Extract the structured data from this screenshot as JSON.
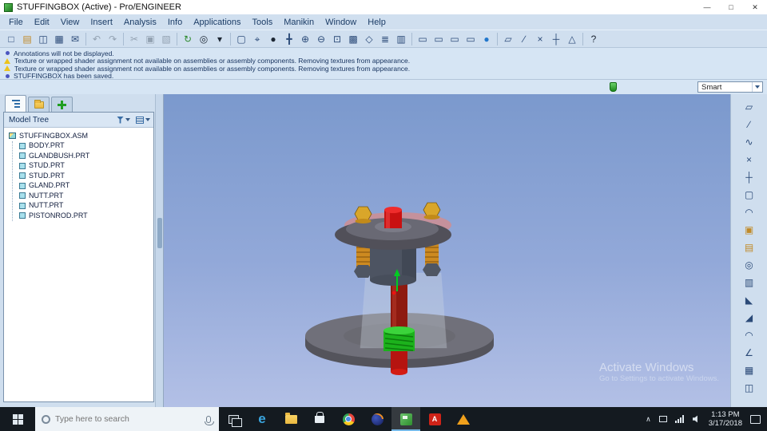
{
  "window": {
    "title": "STUFFINGBOX (Active) - Pro/ENGINEER",
    "minimize": "—",
    "maximize": "□",
    "close": "✕"
  },
  "menubar": {
    "items": [
      "File",
      "Edit",
      "View",
      "Insert",
      "Analysis",
      "Info",
      "Applications",
      "Tools",
      "Manikin",
      "Window",
      "Help"
    ]
  },
  "toolbar": {
    "icons": [
      {
        "name": "new-file-icon",
        "glyph": "□",
        "cls": "tbi tone-blue"
      },
      {
        "name": "open-folder-icon",
        "glyph": "▤",
        "cls": "tbi tone-gold"
      },
      {
        "name": "save-icon",
        "glyph": "◫",
        "cls": "tbi tone-blue"
      },
      {
        "name": "print-icon",
        "glyph": "▦",
        "cls": "tbi tone-blue"
      },
      {
        "name": "mail-icon",
        "glyph": "✉",
        "cls": "tbi tone-blue"
      },
      {
        "name": "undo-icon",
        "glyph": "↶",
        "cls": "tbi tone-gray"
      },
      {
        "name": "redo-icon",
        "glyph": "↷",
        "cls": "tbi tone-gray"
      },
      {
        "name": "cut-icon",
        "glyph": "✂",
        "cls": "tbi tone-gray"
      },
      {
        "name": "copy-icon",
        "glyph": "▣",
        "cls": "tbi tone-gray"
      },
      {
        "name": "paste-icon",
        "glyph": "▧",
        "cls": "tbi tone-gray"
      },
      {
        "name": "regenerate-icon",
        "glyph": "↻",
        "cls": "tbi tone-green"
      },
      {
        "name": "find-icon",
        "glyph": "◎",
        "cls": "tbi tone-dark"
      },
      {
        "name": "filter-caret-icon",
        "glyph": "▾",
        "cls": "tbi tone-dark"
      },
      {
        "name": "select-box-icon",
        "glyph": "▢",
        "cls": "tbi tone-blue"
      },
      {
        "name": "pick-target-icon",
        "glyph": "⌖",
        "cls": "tbi tone-blue"
      },
      {
        "name": "shaded-view-icon",
        "glyph": "●",
        "cls": "tbi tone-dark"
      },
      {
        "name": "spin-center-icon",
        "glyph": "╋",
        "cls": "tbi tone-blue"
      },
      {
        "name": "zoom-in-icon",
        "glyph": "⊕",
        "cls": "tbi tone-blue"
      },
      {
        "name": "zoom-out-icon",
        "glyph": "⊖",
        "cls": "tbi tone-blue"
      },
      {
        "name": "refit-icon",
        "glyph": "⊡",
        "cls": "tbi tone-blue"
      },
      {
        "name": "repaint-icon",
        "glyph": "▩",
        "cls": "tbi tone-blue"
      },
      {
        "name": "orientation-icon",
        "glyph": "◇",
        "cls": "tbi tone-blue"
      },
      {
        "name": "layers-icon",
        "glyph": "≣",
        "cls": "tbi tone-blue"
      },
      {
        "name": "view-manager-icon",
        "glyph": "▥",
        "cls": "tbi tone-blue"
      },
      {
        "name": "new-window-icon",
        "glyph": "▭",
        "cls": "tbi tone-blue"
      },
      {
        "name": "close-window-icon",
        "glyph": "▭",
        "cls": "tbi tone-blue"
      },
      {
        "name": "tile-window-icon",
        "glyph": "▭",
        "cls": "tbi tone-blue"
      },
      {
        "name": "activate-window-icon",
        "glyph": "▭",
        "cls": "tbi tone-blue"
      },
      {
        "name": "user-icon",
        "glyph": "●",
        "cls": "tbi tone-bright"
      },
      {
        "name": "datum-plane-toggle-icon",
        "glyph": "▱",
        "cls": "tbi tone-blue"
      },
      {
        "name": "datum-axis-toggle-icon",
        "glyph": "∕",
        "cls": "tbi tone-blue"
      },
      {
        "name": "datum-point-toggle-icon",
        "glyph": "×",
        "cls": "tbi tone-blue"
      },
      {
        "name": "csys-toggle-icon",
        "glyph": "┼",
        "cls": "tbi tone-blue"
      },
      {
        "name": "annotation-toggle-icon",
        "glyph": "△",
        "cls": "tbi tone-blue"
      },
      {
        "name": "help-pointer-icon",
        "glyph": "?",
        "cls": "tbi tone-dark"
      }
    ]
  },
  "messages": {
    "lines": [
      {
        "type": "info",
        "text": "Annotations will not be displayed."
      },
      {
        "type": "warning",
        "text": "Texture or wrapped shader assignment not available on assemblies or assembly components. Removing textures from appearance."
      },
      {
        "type": "warning",
        "text": "Texture or wrapped shader assignment not available on assemblies or assembly components. Removing textures from appearance."
      },
      {
        "type": "info",
        "text": "STUFFINGBOX has been saved."
      }
    ]
  },
  "selection_filter": {
    "value": "Smart"
  },
  "model_tree": {
    "header": "Model Tree",
    "root": "STUFFINGBOX.ASM",
    "items": [
      "BODY.PRT",
      "GLANDBUSH.PRT",
      "STUD.PRT",
      "STUD.PRT",
      "GLAND.PRT",
      "NUTT.PRT",
      "NUTT.PRT",
      "PISTONROD.PRT"
    ]
  },
  "right_toolbar": {
    "icons": [
      {
        "name": "datum-plane-icon",
        "glyph": "▱",
        "cls": "rbi tone-blue"
      },
      {
        "name": "datum-axis-icon",
        "glyph": "∕",
        "cls": "rbi tone-blue"
      },
      {
        "name": "sketch-icon",
        "glyph": "∿",
        "cls": "rbi tone-blue"
      },
      {
        "name": "datum-point-icon",
        "glyph": "×",
        "cls": "rbi tone-blue"
      },
      {
        "name": "coordinate-system-icon",
        "glyph": "┼",
        "cls": "rbi tone-blue"
      },
      {
        "name": "note-icon",
        "glyph": "▢",
        "cls": "rbi tone-blue"
      },
      {
        "name": "surface-icon",
        "glyph": "◠",
        "cls": "rbi tone-blue"
      },
      {
        "name": "assemble-component-icon",
        "glyph": "▣",
        "cls": "rbi tone-gold"
      },
      {
        "name": "create-component-icon",
        "glyph": "▤",
        "cls": "rbi tone-gold"
      },
      {
        "name": "hole-icon",
        "glyph": "◎",
        "cls": "rbi tone-blue"
      },
      {
        "name": "shell-icon",
        "glyph": "▥",
        "cls": "rbi tone-blue"
      },
      {
        "name": "rib-icon",
        "glyph": "◣",
        "cls": "rbi tone-blue"
      },
      {
        "name": "draft-icon",
        "glyph": "◢",
        "cls": "rbi tone-blue"
      },
      {
        "name": "round-icon",
        "glyph": "◠",
        "cls": "rbi tone-blue"
      },
      {
        "name": "chamfer-icon",
        "glyph": "∠",
        "cls": "rbi tone-blue"
      },
      {
        "name": "pattern-icon",
        "glyph": "▦",
        "cls": "rbi tone-blue"
      },
      {
        "name": "mirror-icon",
        "glyph": "◫",
        "cls": "rbi tone-blue"
      }
    ]
  },
  "viewport": {
    "watermark_title": "Activate Windows",
    "watermark_subtitle": "Go to Settings to activate Windows."
  },
  "taskbar": {
    "search_placeholder": "Type here to search",
    "edge_glyph": "e",
    "acrobat_glyph": "A",
    "tray_chevron": "∧",
    "clock_time": "1:13 PM",
    "clock_date": "3/17/2018"
  },
  "colors": {
    "ui_blue": "#d0dfef",
    "message_blue": "#d6e5f4",
    "viewport_top": "#7b99cd",
    "viewport_bottom": "#b3c0e6",
    "taskbar_dark": "#141a20",
    "active_accent": "#76b9e8",
    "rod_red": "#b51410",
    "gland_green": "#1cb21c",
    "stud_gold": "#cd8a20",
    "flange_gray": "#515059"
  }
}
